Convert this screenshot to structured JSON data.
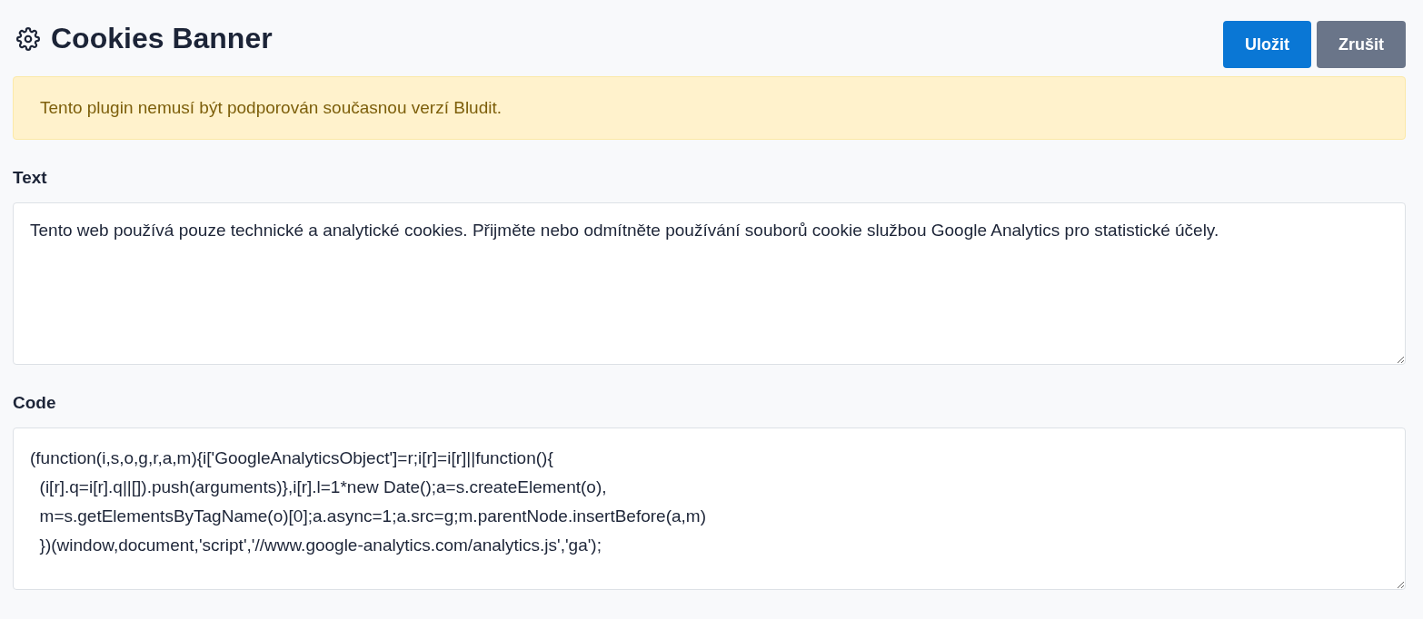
{
  "title": "Cookies Banner",
  "buttons": [
    {
      "label": "Uložit",
      "kind": "primary"
    },
    {
      "label": "Zrušit",
      "kind": "secondary"
    }
  ],
  "alert": "Tento plugin nemusí být podporován současnou verzí Bludit.",
  "fields": [
    {
      "label": "Text",
      "kind": "text",
      "value": "Tento web používá pouze technické a analytické cookies. Přijměte nebo odmítněte používání souborů cookie službou Google Analytics pro statistické účely."
    },
    {
      "label": "Code",
      "kind": "code",
      "lines": [
        "(function(i,s,o,g,r,a,m){i['GoogleAnalyticsObject']=r;i[r]=i[r]||function(){",
        "  (i[r].q=i[r].q||[]).push(arguments)},i[r].l=1*new Date();a=s.createElement(o),",
        "  m=s.getElementsByTagName(o)[0];a.async=1;a.src=g;m.parentNode.insertBefore(a,m)",
        "  })(window,document,'script','//www.google-analytics.com/analytics.js','ga');"
      ]
    }
  ]
}
